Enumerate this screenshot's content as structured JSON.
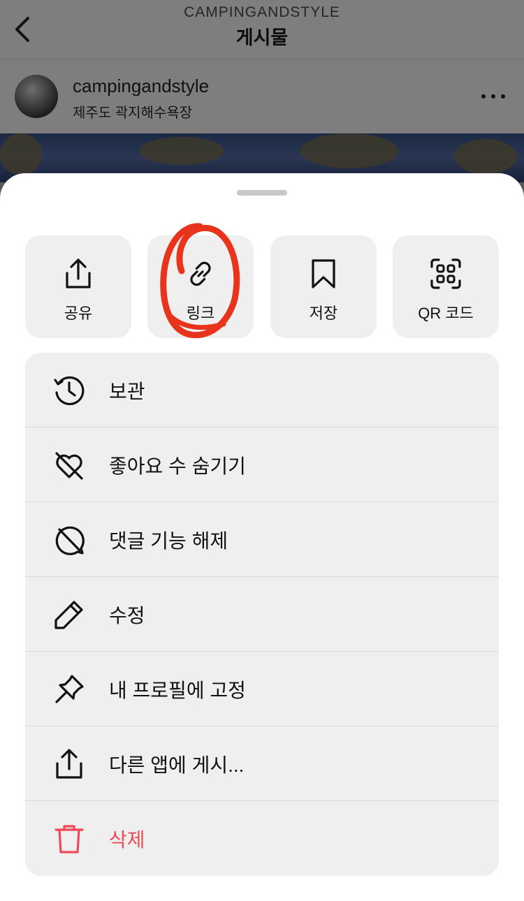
{
  "header": {
    "account": "CAMPINGANDSTYLE",
    "title": "게시물"
  },
  "post": {
    "username": "campingandstyle",
    "location": "제주도 곽지해수욕장"
  },
  "tiles": [
    {
      "label": "공유",
      "icon": "share-icon"
    },
    {
      "label": "링크",
      "icon": "link-icon"
    },
    {
      "label": "저장",
      "icon": "bookmark-icon"
    },
    {
      "label": "QR 코드",
      "icon": "qr-code-icon"
    }
  ],
  "menu": [
    {
      "label": "보관",
      "icon": "archive-history-icon"
    },
    {
      "label": "좋아요 수 숨기기",
      "icon": "heart-off-icon"
    },
    {
      "label": "댓글 기능 해제",
      "icon": "comment-off-icon"
    },
    {
      "label": "수정",
      "icon": "pencil-icon"
    },
    {
      "label": "내 프로필에 고정",
      "icon": "pin-icon"
    },
    {
      "label": "다른 앱에 게시...",
      "icon": "share-icon"
    },
    {
      "label": "삭제",
      "icon": "trash-icon"
    }
  ],
  "colors": {
    "danger": "#ed4956",
    "annotation": "#e8341c",
    "sheet_bg": "#ffffff",
    "item_bg": "#efefef"
  }
}
